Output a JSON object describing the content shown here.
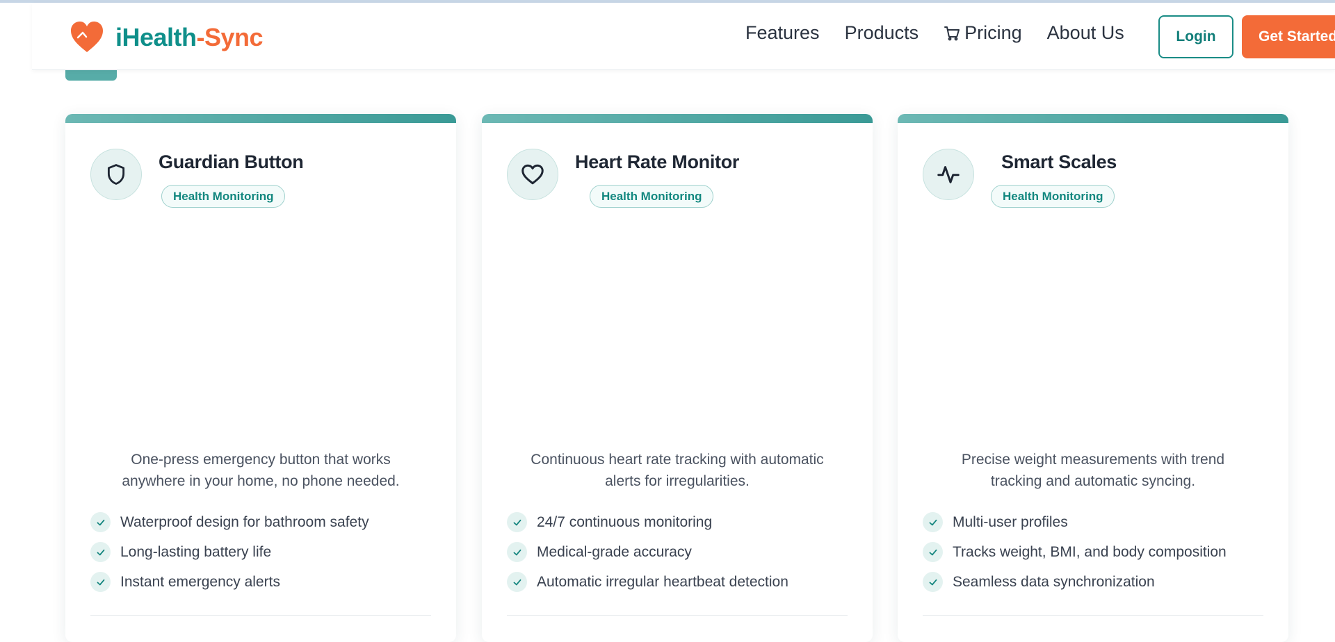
{
  "brand": {
    "name_part1": "iHealth",
    "name_part2": "-Sync",
    "accent": "#0f8f8a",
    "accent2": "#f36b38"
  },
  "nav": {
    "items": [
      {
        "label": "Features"
      },
      {
        "label": "Products"
      },
      {
        "label": "Pricing",
        "icon": "cart-icon"
      },
      {
        "label": "About Us"
      }
    ],
    "login_label": "Login",
    "cta_label": "Get Started"
  },
  "cards": [
    {
      "title": "Guardian Button",
      "icon": "shield-icon",
      "badge": "Health Monitoring",
      "description": "One-press emergency button that works anywhere in your home, no phone needed.",
      "features": [
        "Waterproof design for bathroom safety",
        "Long-lasting battery life",
        "Instant emergency alerts"
      ]
    },
    {
      "title": "Heart Rate Monitor",
      "icon": "heart-icon",
      "badge": "Health Monitoring",
      "description": "Continuous heart rate tracking with automatic alerts for irregularities.",
      "features": [
        "24/7 continuous monitoring",
        "Medical-grade accuracy",
        "Automatic irregular heartbeat detection"
      ]
    },
    {
      "title": "Smart Scales",
      "icon": "activity-icon",
      "badge": "Health Monitoring",
      "description": "Precise weight measurements with trend tracking and automatic syncing.",
      "features": [
        "Multi-user profiles",
        "Tracks weight, BMI, and body composition",
        "Seamless data synchronization"
      ]
    }
  ]
}
